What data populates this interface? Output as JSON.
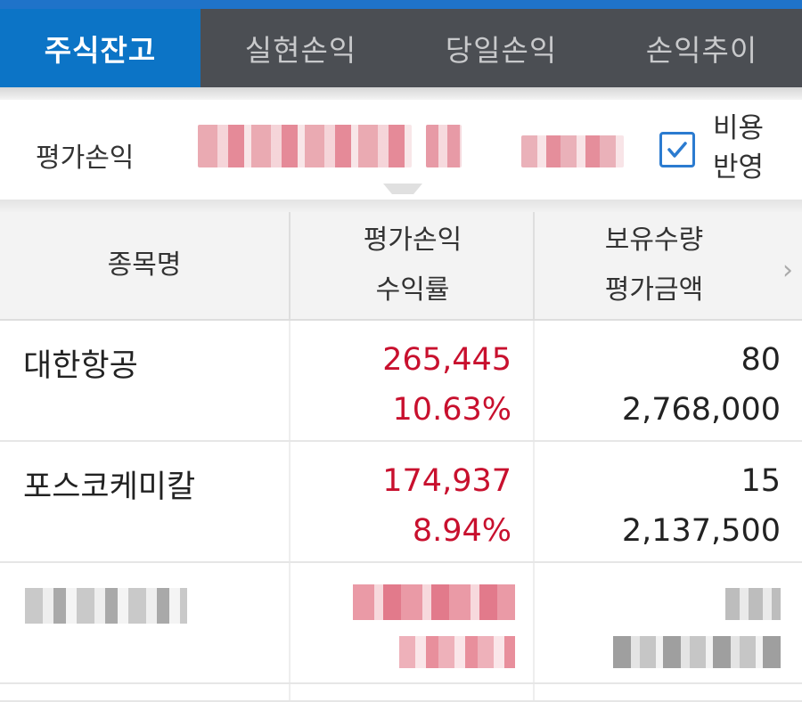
{
  "tabs": [
    {
      "label": "주식잔고",
      "active": true
    },
    {
      "label": "실현손익",
      "active": false
    },
    {
      "label": "당일손익",
      "active": false
    },
    {
      "label": "손익추이",
      "active": false
    }
  ],
  "summary": {
    "label": "평가손익",
    "cost_reflect_label_line1": "비용",
    "cost_reflect_label_line2": "반영",
    "cost_reflect_checked": true
  },
  "table": {
    "headers": {
      "col1": "종목명",
      "col2_line1": "평가손익",
      "col2_line2": "수익률",
      "col3_line1": "보유수량",
      "col3_line2": "평가금액"
    },
    "rows": [
      {
        "name": "대한항공",
        "profit": "265,445",
        "rate": "10.63%",
        "qty": "80",
        "value": "2,768,000"
      },
      {
        "name": "포스코케미칼",
        "profit": "174,937",
        "rate": "8.94%",
        "qty": "15",
        "value": "2,137,500"
      }
    ]
  },
  "colors": {
    "active_tab": "#0c74c6",
    "tab_bar": "#4b4e53",
    "profit_red": "#c8102e",
    "checkbox_blue": "#2b7bd0"
  }
}
